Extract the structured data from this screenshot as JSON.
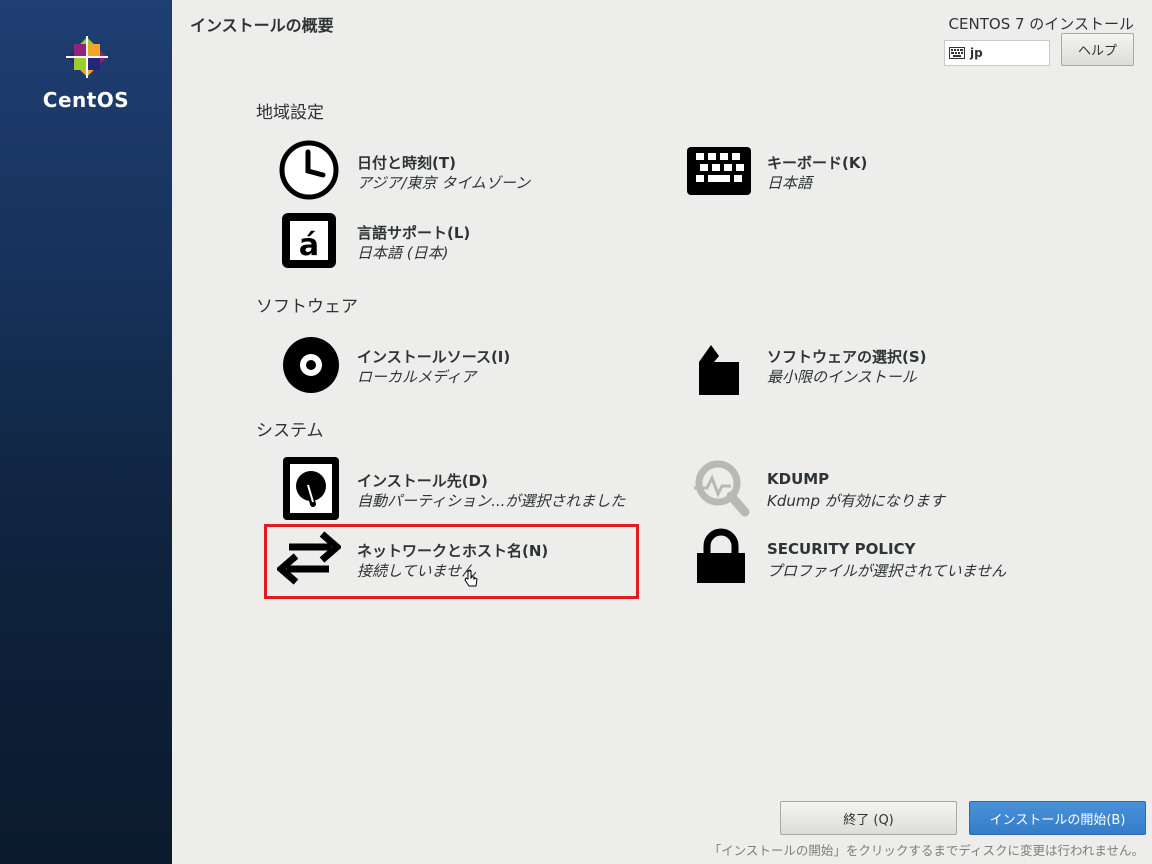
{
  "sidebar": {
    "logo_text": "CentOS"
  },
  "header": {
    "page_title": "インストールの概要",
    "product_title": "CENTOS 7 のインストール",
    "keyboard_layout": "jp",
    "help_label": "ヘルプ"
  },
  "sections": {
    "localization": {
      "title": "地域設定",
      "datetime": {
        "title": "日付と時刻(T)",
        "status": "アジア/東京 タイムゾーン",
        "icon": "clock-icon"
      },
      "keyboard": {
        "title": "キーボード(K)",
        "status": "日本語",
        "icon": "keyboard-icon"
      },
      "language": {
        "title": "言語サポート(L)",
        "status": "日本語 (日本)",
        "icon": "language-icon"
      }
    },
    "software": {
      "title": "ソフトウェア",
      "source": {
        "title": "インストールソース(I)",
        "status": "ローカルメディア",
        "icon": "disc-icon"
      },
      "selection": {
        "title": "ソフトウェアの選択(S)",
        "status": "最小限のインストール",
        "icon": "package-icon"
      }
    },
    "system": {
      "title": "システム",
      "destination": {
        "title": "インストール先(D)",
        "status": "自動パーティション...が選択されました",
        "icon": "harddisk-icon"
      },
      "kdump": {
        "title": "KDUMP",
        "status": "Kdump が有効になります",
        "icon": "kdump-search-icon"
      },
      "network": {
        "title": "ネットワークとホスト名(N)",
        "status": "接続していません",
        "icon": "network-arrows-icon"
      },
      "security": {
        "title": "SECURITY POLICY",
        "status": "プロファイルが選択されていません",
        "icon": "lock-icon"
      }
    }
  },
  "footer": {
    "quit_label": "終了 (Q)",
    "begin_label": "インストールの開始(B)",
    "note": "「インストールの開始」をクリックするまでディスクに変更は行われません。"
  },
  "colors": {
    "sidebar": "#17325c",
    "accent": "#357ec7",
    "highlight": "#e01b24"
  }
}
